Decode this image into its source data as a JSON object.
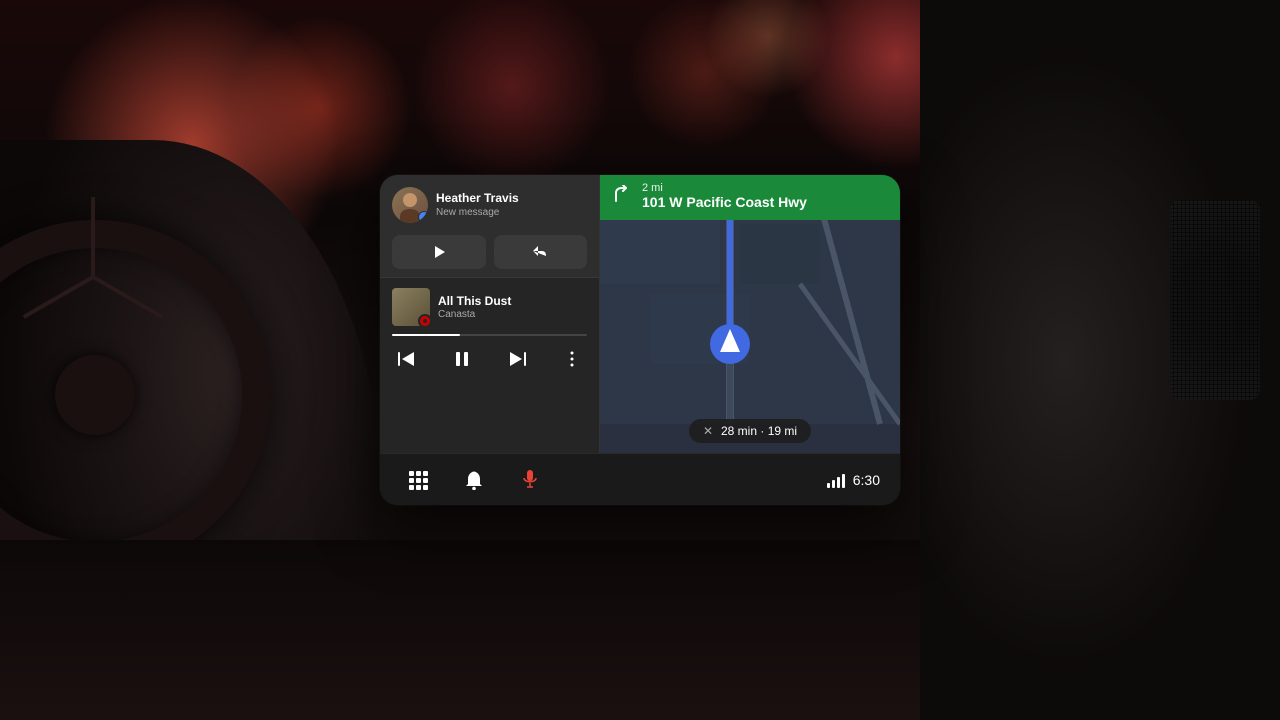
{
  "background": {
    "color": "#1a0808"
  },
  "display": {
    "message_card": {
      "contact_name": "Heather Travis",
      "subtitle": "New message",
      "avatar_badge_color": "#4285f4",
      "play_btn_label": "▶",
      "reply_btn_label": "↩"
    },
    "music_card": {
      "song_title": "All This Dust",
      "artist": "Canasta",
      "progress_pct": 35
    },
    "music_controls": {
      "prev_label": "⏮",
      "pause_label": "⏸",
      "next_label": "⏭",
      "more_label": "⋮"
    },
    "navigation": {
      "turn_distance": "2 mi",
      "turn_street": "101 W Pacific Coast Hwy",
      "turn_icon": "↰",
      "eta_time": "28 min",
      "eta_distance": "19 mi",
      "close_label": "×"
    },
    "bottom_bar": {
      "apps_icon": "⊞",
      "bell_icon": "🔔",
      "mic_icon": "🎤",
      "clock": "6:30"
    }
  }
}
